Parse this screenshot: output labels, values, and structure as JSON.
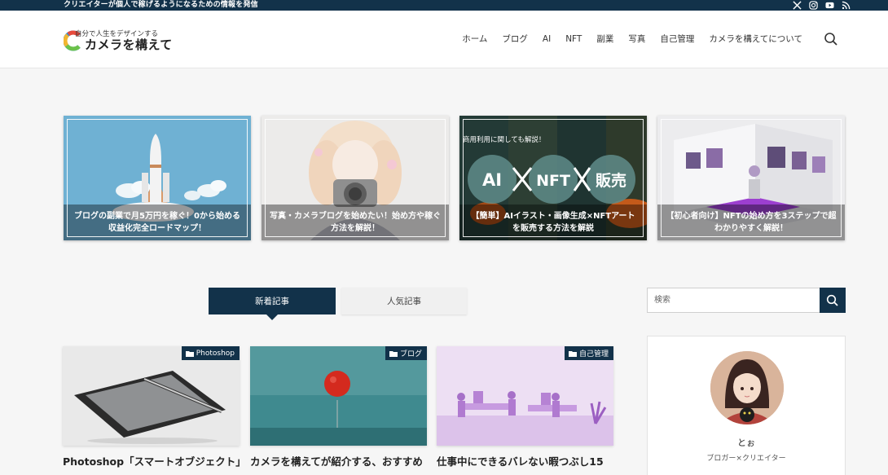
{
  "topbar": {
    "tagline": "クリエイターが個人で稼げるようになるための情報を発信",
    "social_icons": [
      "x-icon",
      "instagram-icon",
      "youtube-icon",
      "rss-icon"
    ]
  },
  "logo": {
    "sub": "自分で人生をデザインする",
    "main": "カメラを構えて"
  },
  "nav": {
    "items": [
      "ホーム",
      "ブログ",
      "AI",
      "NFT",
      "副業",
      "写真",
      "自己管理",
      "カメラを構えてについて"
    ]
  },
  "featured": [
    {
      "caption": "ブログの副業で月5万円を稼ぐ！0から始める収益化完全ロードマップ！"
    },
    {
      "caption": "写真・カメラブログを始めたい！始め方や稼ぐ方法を解説！"
    },
    {
      "caption": "【簡単】AIイラスト・画像生成×NFTアートを販売する方法を解説",
      "top_text": "商用利用に関しても解説！",
      "art_words": [
        "AI",
        "NFT",
        "販売"
      ]
    },
    {
      "caption": "【初心者向け】NFTの始め方を3ステップで超わかりやすく解説！"
    }
  ],
  "tabs": {
    "new": "新着記事",
    "popular": "人気記事"
  },
  "articles": [
    {
      "category": "Photoshop",
      "title": "Photoshop「スマートオブジェクト」"
    },
    {
      "category": "ブログ",
      "title": "カメラを構えてが紹介する、おすすめ"
    },
    {
      "category": "自己管理",
      "title": "仕事中にできるバレない暇つぶし15"
    }
  ],
  "sidebar": {
    "search_placeholder": "検索",
    "profile_name": "とぉ",
    "profile_role": "ブロガー×クリエイター"
  },
  "colors": {
    "brand_navy": "#12324a",
    "accent_purple": "#9c3fd0"
  }
}
